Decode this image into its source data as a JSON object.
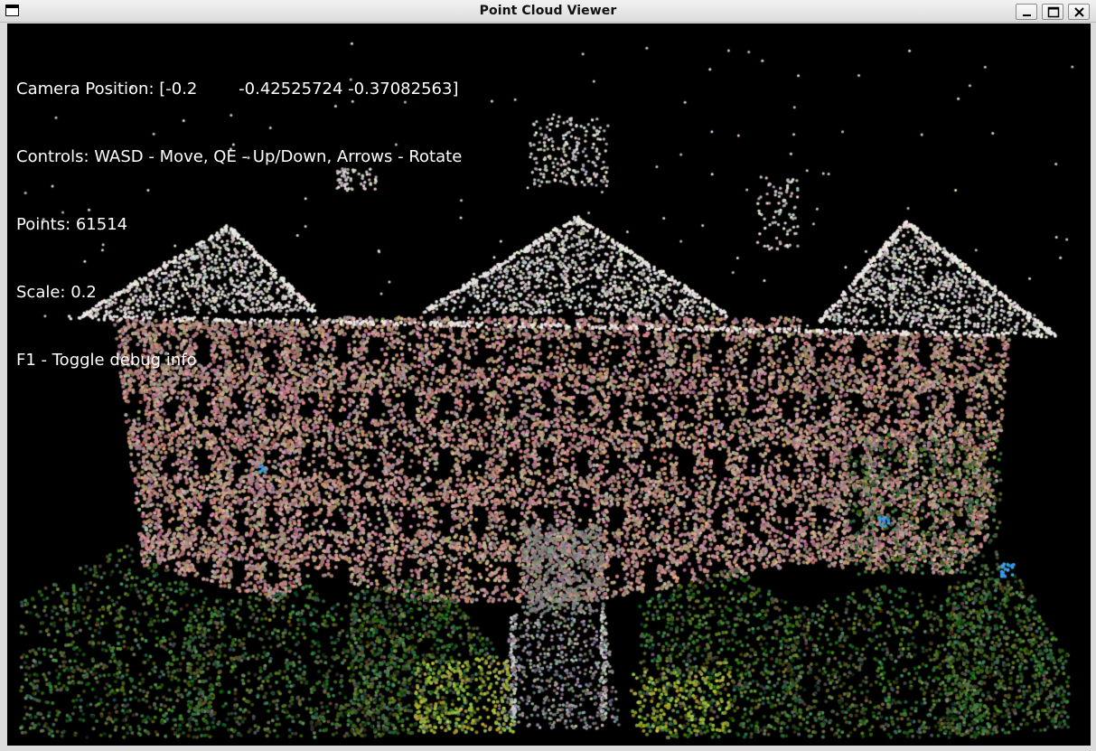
{
  "window": {
    "title": "Point Cloud Viewer",
    "buttons": [
      "minimize",
      "maximize",
      "close"
    ]
  },
  "hud": {
    "camera_position": "Camera Position: [-0.2        -0.42525724 -0.37082563]",
    "controls": "Controls: WASD - Move, QE - Up/Down, Arrows - Rotate",
    "points": "Points: 61514",
    "scale": "Scale: 0.2",
    "debug_hint": "F1 - Toggle debug info"
  },
  "scene": {
    "background": "#000000",
    "facade_color": "#c9a49a",
    "roof_color": "#e8e4df",
    "foliage_color": "#5a7a4a",
    "highlight_foliage_color": "#a8b84a",
    "accent_blue": "#3a9ae0"
  }
}
